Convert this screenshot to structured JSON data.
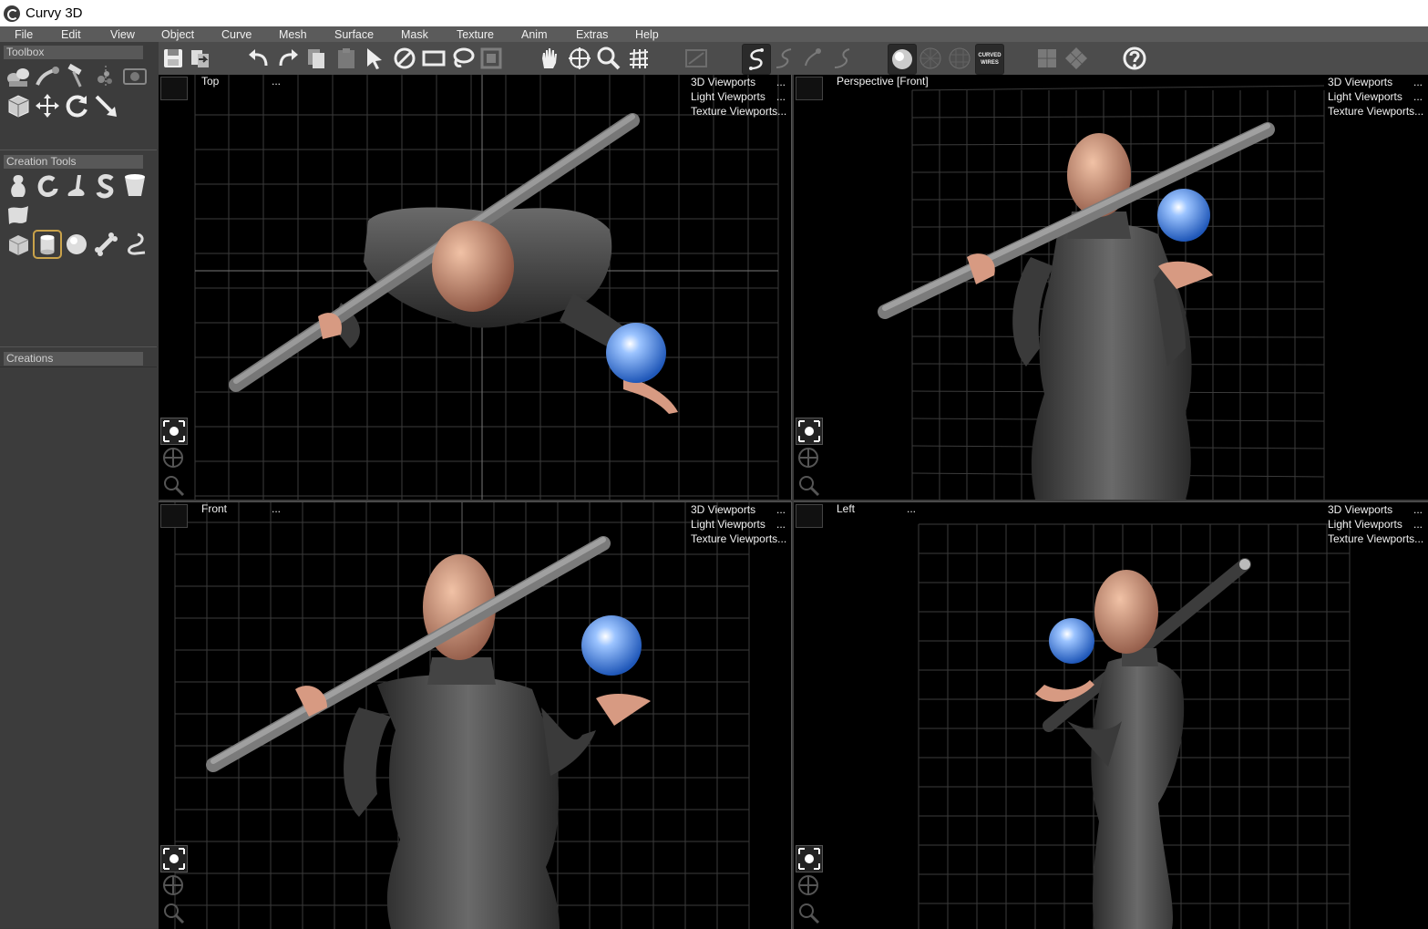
{
  "window": {
    "title": "Curvy 3D"
  },
  "menu": [
    "File",
    "Edit",
    "View",
    "Object",
    "Curve",
    "Mesh",
    "Surface",
    "Mask",
    "Texture",
    "Anim",
    "Extras",
    "Help"
  ],
  "toolbar": {
    "curved_wires_label": "CURVED\nWIRES",
    "curved_wires_line1": "CURVED",
    "curved_wires_line2": "WIRES"
  },
  "left_panel": {
    "toolbox_title": "Toolbox",
    "creation_tools_title": "Creation Tools",
    "creations_title": "Creations"
  },
  "viewports": [
    {
      "name": "Top",
      "dots": "...",
      "menu": [
        "3D Viewports",
        "Light Viewports",
        "Texture Viewports"
      ],
      "menu_dots": "..."
    },
    {
      "name": "Perspective [Front]",
      "dots": "",
      "menu": [
        "3D Viewports",
        "Light Viewports",
        "Texture Viewports"
      ],
      "menu_dots": "..."
    },
    {
      "name": "Front",
      "dots": "...",
      "menu": [
        "3D Viewports",
        "Light Viewports",
        "Texture Viewports"
      ],
      "menu_dots": "..."
    },
    {
      "name": "Left",
      "dots": "...",
      "menu": [
        "3D Viewports",
        "Light Viewports",
        "Texture Viewports"
      ],
      "menu_dots": "..."
    }
  ]
}
